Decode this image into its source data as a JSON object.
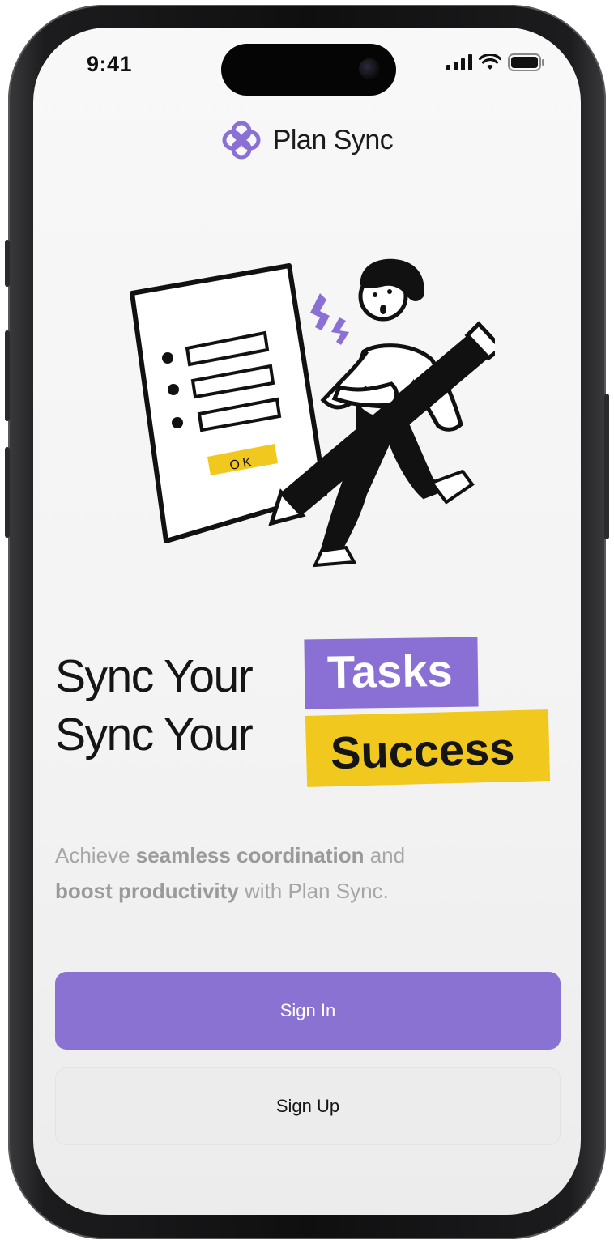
{
  "status_bar": {
    "time": "9:41"
  },
  "brand": {
    "name": "Plan Sync",
    "color": "#8a70d4"
  },
  "illustration": {
    "button_text": "OK"
  },
  "headline": {
    "line1_prefix": "Sync Your",
    "line1_tag": "Tasks",
    "line2_prefix": "Sync Your",
    "line2_tag": "Success"
  },
  "description": {
    "part1": "Achieve ",
    "bold1": "seamless coordination",
    "part2": " and ",
    "bold2": "boost productivity",
    "part3": " with Plan Sync."
  },
  "buttons": {
    "sign_in": "Sign In",
    "sign_up": "Sign Up"
  },
  "colors": {
    "accent": "#8a70d4",
    "highlight": "#f0c81e"
  }
}
